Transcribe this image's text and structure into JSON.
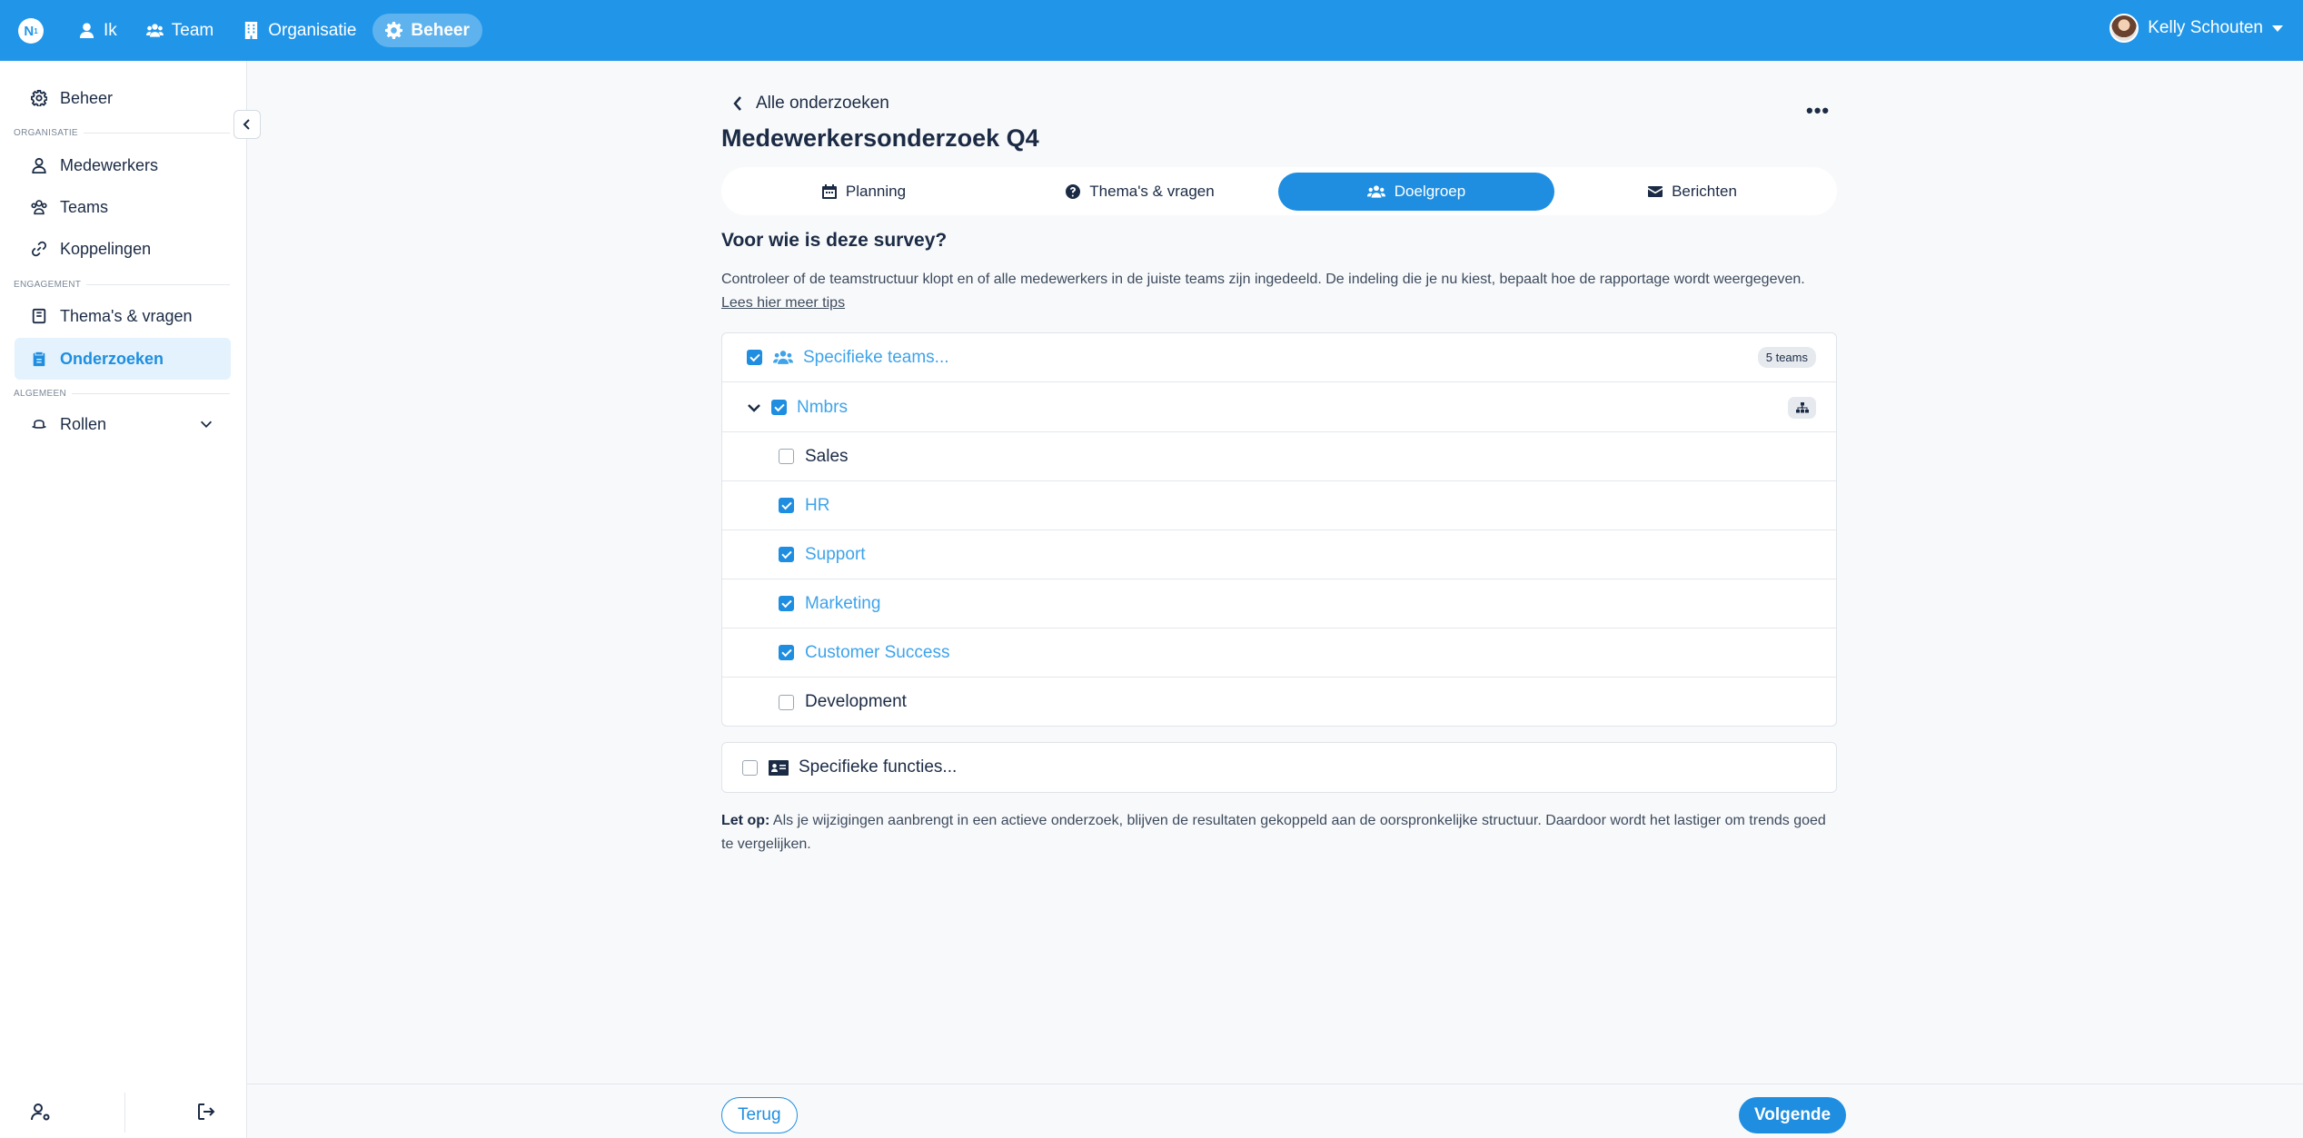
{
  "topbar": {
    "logo": "N",
    "nav": [
      {
        "label": "Ik",
        "icon": "user-icon"
      },
      {
        "label": "Team",
        "icon": "users-icon"
      },
      {
        "label": "Organisatie",
        "icon": "building-icon"
      },
      {
        "label": "Beheer",
        "icon": "gear-icon",
        "active": true
      }
    ],
    "user_name": "Kelly Schouten"
  },
  "sidebar": {
    "top_item": "Beheer",
    "section_organisatie": "ORGANISATIE",
    "items_organisatie": [
      "Medewerkers",
      "Teams",
      "Koppelingen"
    ],
    "section_engagement": "ENGAGEMENT",
    "items_engagement": [
      "Thema's & vragen",
      "Onderzoeken"
    ],
    "section_algemeen": "ALGEMEEN",
    "items_algemeen": [
      "Rollen"
    ],
    "active_item": "Onderzoeken"
  },
  "header": {
    "back_label": "Alle onderzoeken",
    "title": "Medewerkersonderzoek Q4",
    "more": "•••"
  },
  "tabs": [
    {
      "label": "Planning",
      "icon": "calendar-icon"
    },
    {
      "label": "Thema's & vragen",
      "icon": "question-circle-icon"
    },
    {
      "label": "Doelgroep",
      "icon": "users-icon",
      "active": true
    },
    {
      "label": "Berichten",
      "icon": "envelope-icon"
    }
  ],
  "content": {
    "section_title": "Voor wie is deze survey?",
    "description": "Controleer of de teamstructuur klopt en of alle medewerkers in de juiste teams zijn ingedeeld. De indeling die je nu kiest, bepaalt hoe de rapportage wordt weergegeven.",
    "tips_link": "Lees hier meer tips",
    "specific_teams_label": "Specifieke teams...",
    "teams_badge": "5 teams",
    "org_label": "Nmbrs",
    "teams": [
      {
        "name": "Sales",
        "checked": false
      },
      {
        "name": "HR",
        "checked": true
      },
      {
        "name": "Support",
        "checked": true
      },
      {
        "name": "Marketing",
        "checked": true
      },
      {
        "name": "Customer Success",
        "checked": true
      },
      {
        "name": "Development",
        "checked": false
      }
    ],
    "specific_functions_label": "Specifieke functies...",
    "note_label": "Let op:",
    "note_text": "Als je wijzigingen aanbrengt in een actieve onderzoek, blijven de resultaten gekoppeld aan de oorspronkelijke structuur. Daardoor wordt het lastiger om trends goed te vergelijken."
  },
  "footer": {
    "back_button": "Terug",
    "next_button": "Volgende"
  },
  "colors": {
    "brand": "#2196e9",
    "accent": "#1f8ee0",
    "selected_text": "#3ea3ea",
    "text": "#1b2b45"
  }
}
